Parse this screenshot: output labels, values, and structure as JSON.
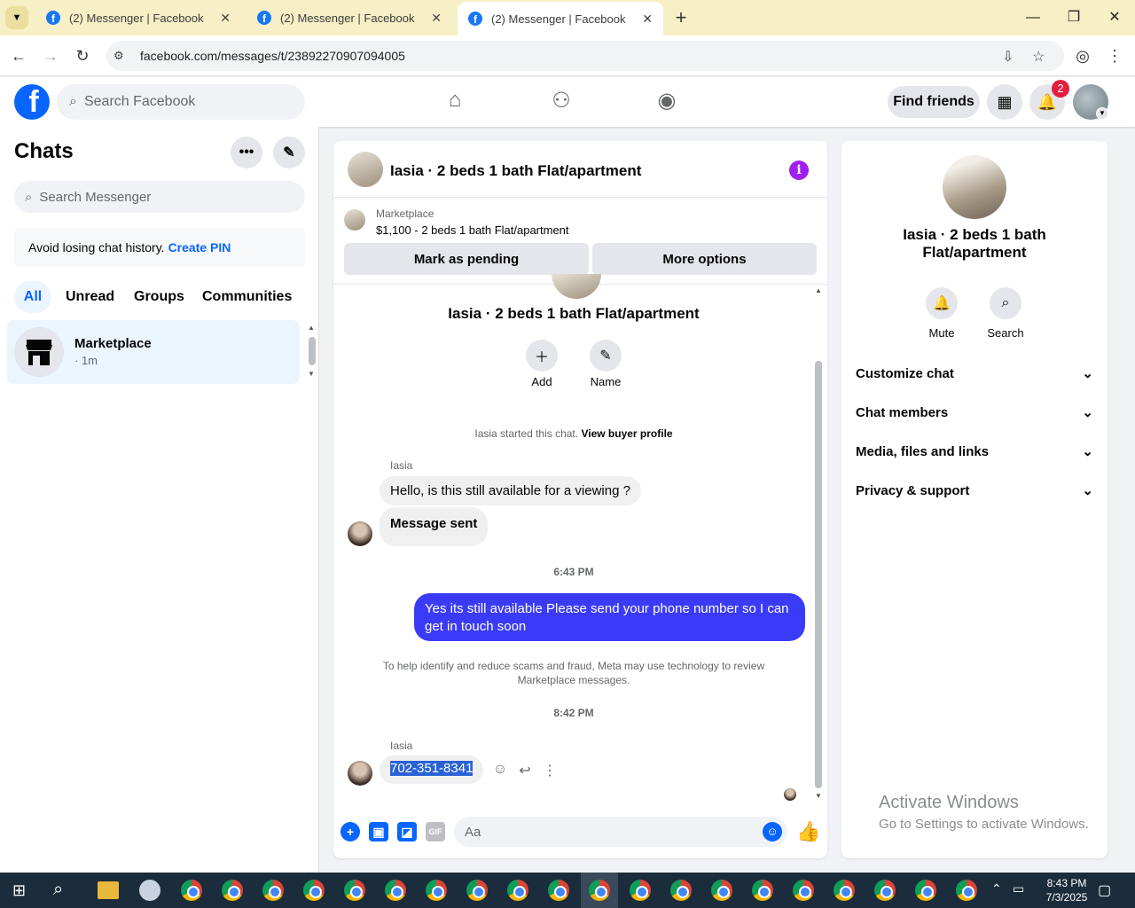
{
  "browser": {
    "tabs": [
      {
        "title": "(2) Messenger | Facebook",
        "active": false
      },
      {
        "title": "(2) Messenger | Facebook",
        "active": false
      },
      {
        "title": "(2) Messenger | Facebook",
        "active": true
      }
    ],
    "url": "facebook.com/messages/t/23892270907094005"
  },
  "header": {
    "search_placeholder": "Search Facebook",
    "find_friends": "Find friends",
    "notification_count": "2"
  },
  "chats": {
    "title": "Chats",
    "search_placeholder": "Search Messenger",
    "pin_notice": "Avoid losing chat history.",
    "pin_link": "Create PIN",
    "filters": [
      "All",
      "Unread",
      "Groups",
      "Communities"
    ],
    "conversations": [
      {
        "name": "Marketplace",
        "subtitle": "· 1m"
      }
    ]
  },
  "conversation": {
    "title": "Iasia · 2 beds 1 bath Flat/apartment",
    "marketplace_label": "Marketplace",
    "listing": "$1,100 - 2 beds 1 bath Flat/apartment",
    "mark_pending": "Mark as pending",
    "more_options": "More options",
    "center_title": "Iasia · 2 beds 1 bath Flat/apartment",
    "add_label": "Add",
    "name_label": "Name",
    "started_text": "Iasia started this chat.",
    "buyer_link": "View buyer profile",
    "sender": "Iasia",
    "msg1": "Hello, is this still available for a viewing ?",
    "msg2": "Message sent",
    "time1": "6:43 PM",
    "outgoing": "Yes its still available Please send your phone number so I can get in touch soon",
    "scam_note": "To help identify and reduce scams and fraud, Meta may use technology to review Marketplace messages.",
    "time2": "8:42 PM",
    "sender2": "Iasia",
    "phone": "702-351-8341",
    "composer_placeholder": "Aa",
    "gif_label": "GIF"
  },
  "info_panel": {
    "title": "Iasia · 2 beds 1 bath Flat/apartment",
    "mute": "Mute",
    "search": "Search",
    "sections": [
      "Customize chat",
      "Chat members",
      "Media, files and links",
      "Privacy & support"
    ]
  },
  "watermark": {
    "title": "Activate Windows",
    "subtitle": "Go to Settings to activate Windows."
  },
  "taskbar": {
    "time": "8:43 PM",
    "date": "7/3/2025"
  }
}
